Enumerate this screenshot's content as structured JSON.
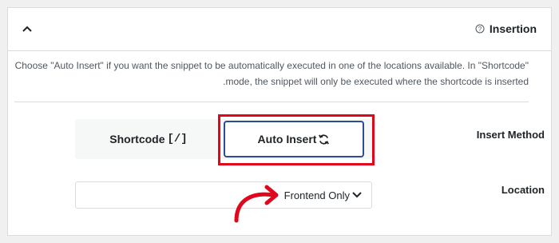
{
  "header": {
    "title": "Insertion",
    "help_icon": "help-circle-icon",
    "collapse_icon": "chevron-up-icon"
  },
  "description": {
    "line1": "Choose \"Auto Insert\" if you want the snippet to be automatically executed in one of the locations available. In \"Shortcode\"",
    "line2": ".mode, the snippet will only be executed where the shortcode is inserted"
  },
  "insert_method": {
    "label": "Insert Method",
    "options": [
      {
        "label": "Shortcode",
        "icon": "brackets-icon",
        "icon_text": "[/]"
      },
      {
        "label": "Auto Insert",
        "icon": "refresh-icon",
        "selected": true
      }
    ]
  },
  "location": {
    "label": "Location",
    "value": "Frontend Only",
    "icon": "chevron-down-icon"
  },
  "colors": {
    "accent": "#2b4c9b",
    "highlight": "#e0061b"
  }
}
